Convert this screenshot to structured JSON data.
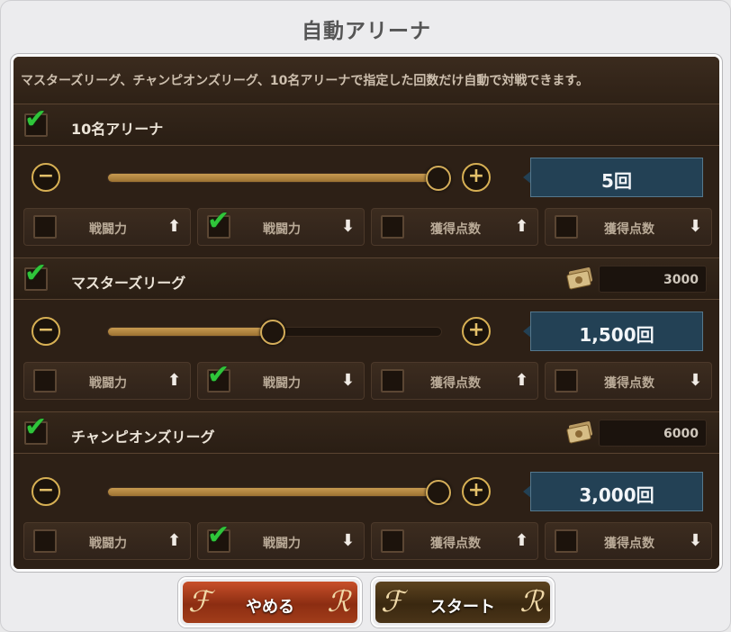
{
  "title": "自動アリーナ",
  "description": "マスターズリーグ、チャンピオンズリーグ、10名アリーナで指定した回数だけ自動で対戦できます。",
  "sections": [
    {
      "label": "10名アリーナ",
      "checked": true,
      "ticket_cost": null,
      "slider_fraction": 1.0,
      "count": "5回",
      "options": [
        {
          "label": "戦闘力",
          "arrow": "⬆",
          "checked": false
        },
        {
          "label": "戦闘力",
          "arrow": "⬇",
          "checked": true
        },
        {
          "label": "獲得点数",
          "arrow": "⬆",
          "checked": false
        },
        {
          "label": "獲得点数",
          "arrow": "⬇",
          "checked": false
        }
      ]
    },
    {
      "label": "マスターズリーグ",
      "checked": true,
      "ticket_cost": "3000",
      "slider_fraction": 0.5,
      "count": "1,500回",
      "options": [
        {
          "label": "戦闘力",
          "arrow": "⬆",
          "checked": false
        },
        {
          "label": "戦闘力",
          "arrow": "⬇",
          "checked": true
        },
        {
          "label": "獲得点数",
          "arrow": "⬆",
          "checked": false
        },
        {
          "label": "獲得点数",
          "arrow": "⬇",
          "checked": false
        }
      ]
    },
    {
      "label": "チャンピオンズリーグ",
      "checked": true,
      "ticket_cost": "6000",
      "slider_fraction": 1.0,
      "count": "3,000回",
      "options": [
        {
          "label": "戦闘力",
          "arrow": "⬆",
          "checked": false
        },
        {
          "label": "戦闘力",
          "arrow": "⬇",
          "checked": true
        },
        {
          "label": "獲得点数",
          "arrow": "⬆",
          "checked": false
        },
        {
          "label": "獲得点数",
          "arrow": "⬇",
          "checked": false
        }
      ]
    }
  ],
  "buttons": {
    "cancel": "やめる",
    "start": "スタート"
  },
  "icons": {
    "minus": "−",
    "plus": "+",
    "check": "✔",
    "ticket": "ticket-icon"
  },
  "colors": {
    "check": "#2fc53a",
    "accent_gold": "#d7b054",
    "count_bg": "#234155",
    "cancel_btn": "#a23d1a",
    "start_btn": "#4a3418"
  }
}
